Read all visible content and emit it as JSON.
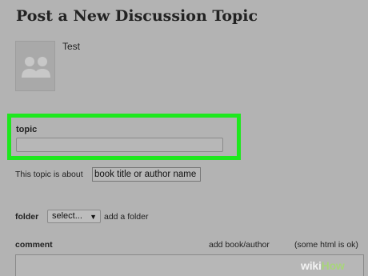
{
  "page": {
    "title": "Post a New Discussion Topic"
  },
  "user": {
    "name": "Test"
  },
  "topic": {
    "label": "topic",
    "value": ""
  },
  "about": {
    "label": "This topic is about",
    "placeholder": "book title or author name"
  },
  "folder": {
    "label": "folder",
    "selected": "select...",
    "caret": "▼",
    "add_label": "add a folder"
  },
  "comment": {
    "label": "comment",
    "add_book_label": "add book/author",
    "html_note": "(some html is ok)"
  },
  "watermark": {
    "part1": "wiki",
    "part2": "How"
  },
  "colors": {
    "background": "#b3b3b3",
    "highlight": "#1ee81e"
  },
  "icons": {
    "avatar": "user-group-icon"
  }
}
